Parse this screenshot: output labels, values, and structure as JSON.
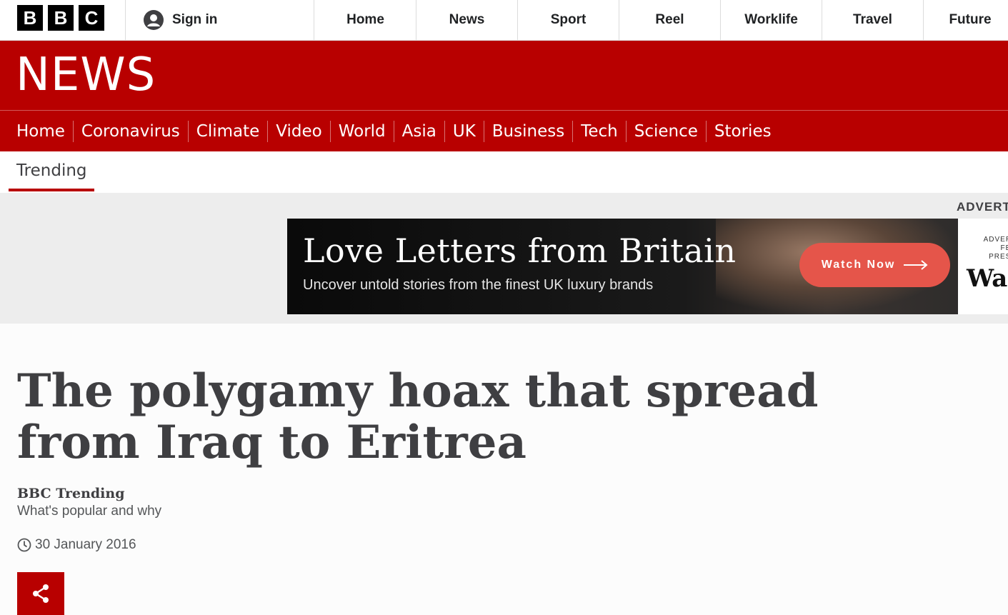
{
  "global_header": {
    "logo_letters": [
      "B",
      "B",
      "C"
    ],
    "sign_in_label": "Sign in",
    "nav_items": [
      "Home",
      "News",
      "Sport",
      "Reel",
      "Worklife",
      "Travel",
      "Future"
    ]
  },
  "news_banner": {
    "wordmark": "NEWS",
    "brand_color": "#b80000"
  },
  "section_nav": {
    "items": [
      "Home",
      "Coronavirus",
      "Climate",
      "Video",
      "World",
      "Asia",
      "UK",
      "Business",
      "Tech",
      "Science",
      "Stories"
    ]
  },
  "subnav": {
    "active_item": "Trending"
  },
  "advert": {
    "label": "ADVERT",
    "title": "Love Letters from Britain",
    "subtitle": "Uncover untold stories from the finest UK luxury brands",
    "cta_label": "Watch Now",
    "side_text_lines": [
      "ADVERT",
      "FEA",
      "PRESE"
    ],
    "side_brand": "Wal",
    "cta_color": "#e5554a"
  },
  "article": {
    "headline": "The polygamy hoax that spread from Iraq to Eritrea",
    "byline_name": "BBC Trending",
    "byline_role": "What's popular and why",
    "date": "30 January 2016"
  },
  "icons": {
    "user": "user-icon",
    "clock": "clock-icon",
    "share": "share-icon",
    "arrow": "arrow-right-icon"
  }
}
